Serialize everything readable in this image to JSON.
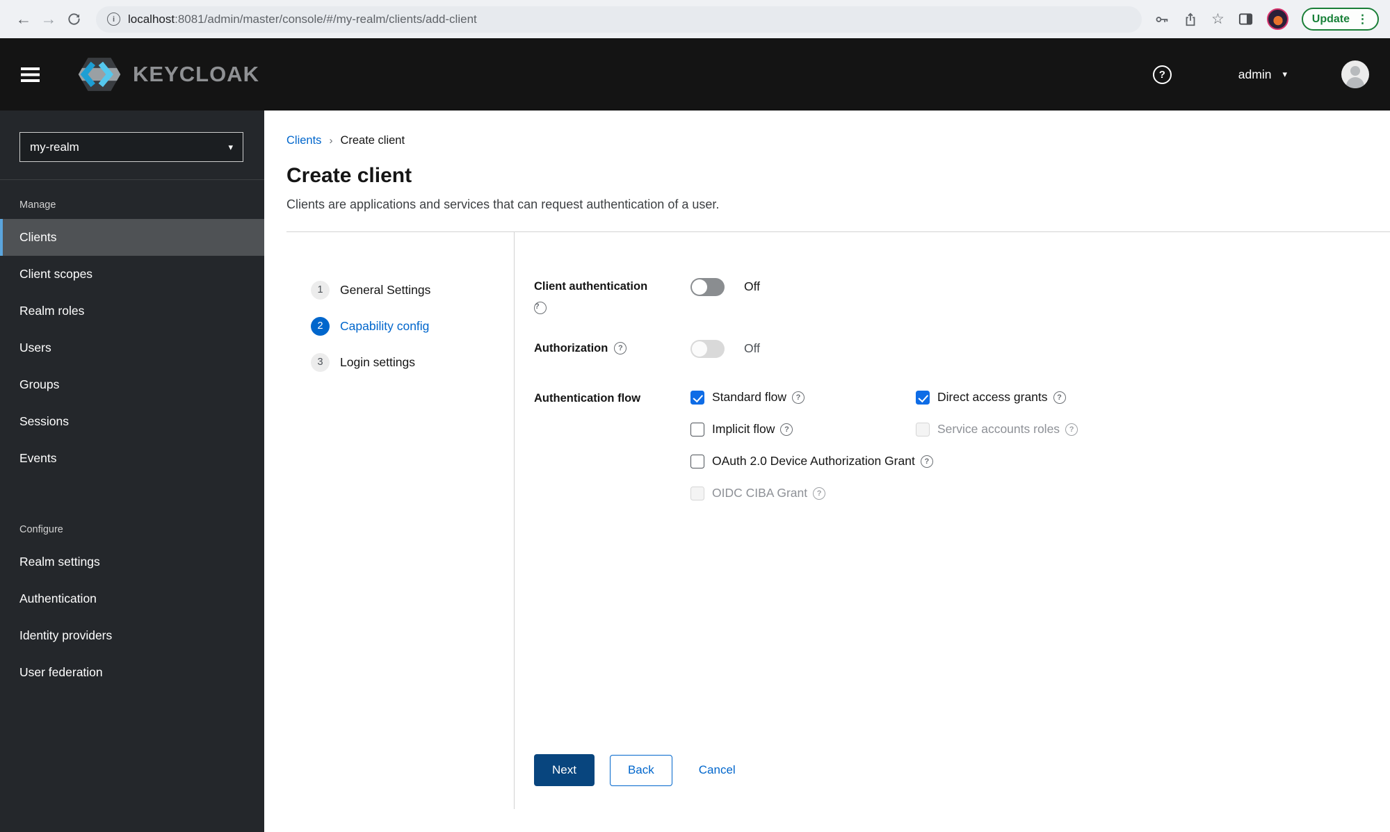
{
  "browser": {
    "url": {
      "host": "localhost",
      "rest": ":8081/admin/master/console/#/my-realm/clients/add-client"
    },
    "update_button": "Update"
  },
  "icons": {
    "back": "←",
    "forward": "→",
    "info": "i",
    "star": "☆",
    "kebab": "⋮",
    "caret": "▾",
    "question": "?",
    "breadcrumb_separator": "›"
  },
  "masthead": {
    "brand": "KEYCLOAK",
    "username": "admin"
  },
  "sidebar": {
    "realm_selector": {
      "value": "my-realm"
    },
    "sections": [
      {
        "title": "Manage",
        "items": [
          {
            "label": "Clients"
          },
          {
            "label": "Client scopes"
          },
          {
            "label": "Realm roles"
          },
          {
            "label": "Users"
          },
          {
            "label": "Groups"
          },
          {
            "label": "Sessions"
          },
          {
            "label": "Events"
          }
        ]
      },
      {
        "title": "Configure",
        "items": [
          {
            "label": "Realm settings"
          },
          {
            "label": "Authentication"
          },
          {
            "label": "Identity providers"
          },
          {
            "label": "User federation"
          }
        ]
      }
    ]
  },
  "page": {
    "breadcrumb": [
      {
        "label": "Clients"
      },
      {
        "label": "Create client"
      }
    ],
    "title": "Create client",
    "subtitle": "Clients are applications and services that can request authentication of a user."
  },
  "wizard": {
    "steps": [
      {
        "number": "1",
        "label": "General Settings"
      },
      {
        "number": "2",
        "label": "Capability config"
      },
      {
        "number": "3",
        "label": "Login settings"
      }
    ]
  },
  "form": {
    "fields": {
      "client_authentication": {
        "label": "Client authentication",
        "state": "Off"
      },
      "authorization": {
        "label": "Authorization",
        "state": "Off"
      },
      "authentication_flow": {
        "label": "Authentication flow"
      }
    },
    "flow_options": [
      {
        "label": "Standard flow",
        "checked": true,
        "disabled": false
      },
      {
        "label": "Direct access grants",
        "checked": true,
        "disabled": false
      },
      {
        "label": "Implicit flow",
        "checked": false,
        "disabled": false
      },
      {
        "label": "Service accounts roles",
        "checked": false,
        "disabled": true
      },
      {
        "label": "OAuth 2.0 Device Authorization Grant",
        "checked": false,
        "disabled": false
      },
      {
        "label": "OIDC CIBA Grant",
        "checked": false,
        "disabled": true
      }
    ],
    "actions": {
      "next": "Next",
      "back": "Back",
      "cancel": "Cancel"
    }
  },
  "colors": {
    "accent_blue": "#0066cc",
    "checkbox_checked": "#0e6ce6",
    "primary_button": "#08457e",
    "nav_selected_bg": "#4f5255",
    "nav_selected_border": "#5ba5dd",
    "masthead_bg": "#141414",
    "sidebar_bg": "#24272b",
    "update_green": "#188038"
  }
}
